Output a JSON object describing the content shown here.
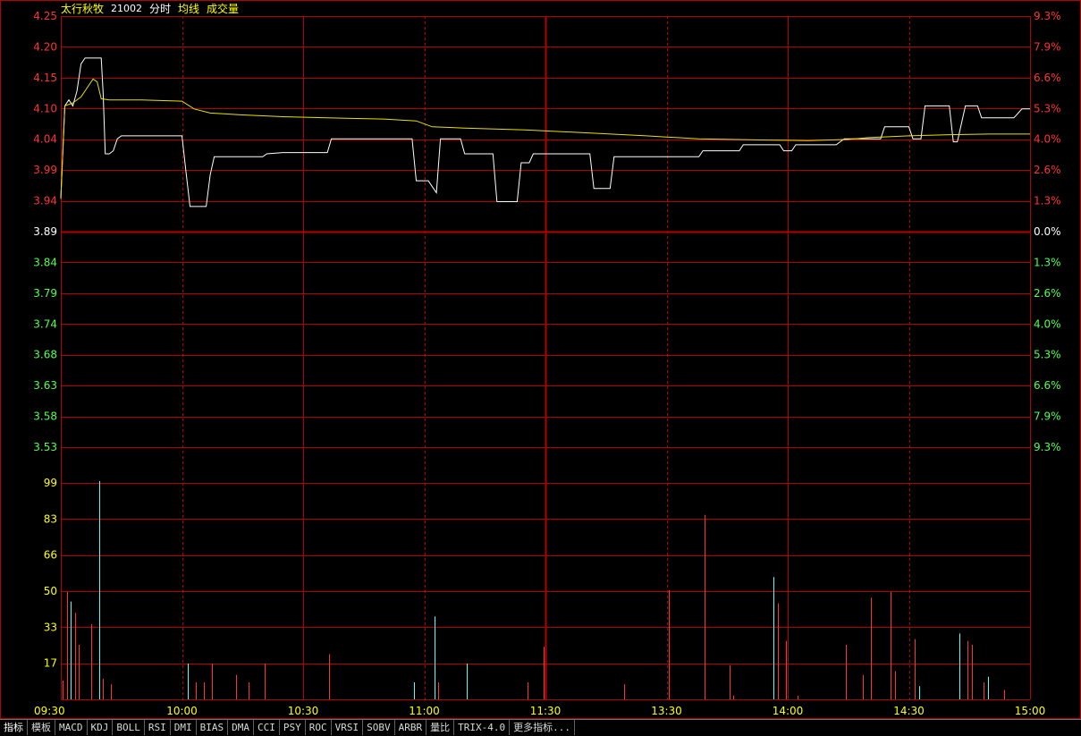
{
  "header": {
    "stock_name": "太行秋牧",
    "stock_code": "21002",
    "legend_price": "分时",
    "legend_avg": "均线",
    "legend_volume": "成交量"
  },
  "colors": {
    "background": "#000000",
    "grid": "#b40000",
    "price_line": "#ffffff",
    "avg_line": "#e8e000",
    "up": "#ff3232",
    "down": "#50ff50",
    "neutral": "#ffffff",
    "volume_up": "#ff3232",
    "volume_down": "#50ffff",
    "volume_axis": "#ffff00",
    "time_axis": "#ffff00"
  },
  "chart_data": {
    "type": "line",
    "price_axis": {
      "ticks": [
        "4.25",
        "4.20",
        "4.15",
        "4.10",
        "4.04",
        "3.99",
        "3.94",
        "3.89",
        "3.84",
        "3.79",
        "3.74",
        "3.68",
        "3.63",
        "3.58",
        "3.53"
      ],
      "prev_close": 3.89,
      "ylim": [
        3.53,
        4.25
      ]
    },
    "percent_axis": {
      "ticks": [
        "9.3%",
        "7.9%",
        "6.6%",
        "5.3%",
        "4.0%",
        "2.6%",
        "1.3%",
        "0.0%",
        "1.3%",
        "2.6%",
        "4.0%",
        "5.3%",
        "6.6%",
        "7.9%",
        "9.3%"
      ]
    },
    "volume_axis": {
      "ticks": [
        "99",
        "83",
        "66",
        "50",
        "33",
        "17"
      ],
      "ylim": [
        0,
        115
      ]
    },
    "time_axis": {
      "ticks": [
        "09:30",
        "10:00",
        "10:30",
        "11:00",
        "11:30",
        "13:30",
        "14:00",
        "14:30",
        "15:00"
      ],
      "total_minutes": 240
    },
    "series": [
      {
        "name": "分时",
        "points": [
          [
            0,
            3.945
          ],
          [
            1,
            4.1
          ],
          [
            2,
            4.11
          ],
          [
            3,
            4.1
          ],
          [
            4,
            4.125
          ],
          [
            5,
            4.17
          ],
          [
            6,
            4.18
          ],
          [
            7,
            4.18
          ],
          [
            8,
            4.18
          ],
          [
            9,
            4.18
          ],
          [
            10,
            4.18
          ],
          [
            10.5,
            4.12
          ],
          [
            11,
            4.02
          ],
          [
            12,
            4.02
          ],
          [
            13,
            4.025
          ],
          [
            14,
            4.045
          ],
          [
            15,
            4.05
          ],
          [
            16,
            4.05
          ],
          [
            25,
            4.05
          ],
          [
            30,
            4.05
          ],
          [
            31,
            3.99
          ],
          [
            32,
            3.932
          ],
          [
            35,
            3.932
          ],
          [
            36,
            3.932
          ],
          [
            37,
            3.985
          ],
          [
            38,
            4.015
          ],
          [
            42,
            4.015
          ],
          [
            50,
            4.015
          ],
          [
            51,
            4.02
          ],
          [
            55,
            4.022
          ],
          [
            66,
            4.022
          ],
          [
            67,
            4.045
          ],
          [
            70,
            4.045
          ],
          [
            86,
            4.045
          ],
          [
            87,
            4.045
          ],
          [
            88,
            3.975
          ],
          [
            91,
            3.975
          ],
          [
            92,
            3.965
          ],
          [
            93,
            3.955
          ],
          [
            94,
            4.045
          ],
          [
            99,
            4.045
          ],
          [
            100,
            4.02
          ],
          [
            107,
            4.02
          ],
          [
            108,
            3.94
          ],
          [
            113,
            3.94
          ],
          [
            114,
            4.005
          ],
          [
            116,
            4.005
          ],
          [
            117,
            4.02
          ],
          [
            131,
            4.02
          ],
          [
            132,
            3.962
          ],
          [
            136,
            3.962
          ],
          [
            137,
            4.015
          ],
          [
            142,
            4.015
          ],
          [
            158,
            4.015
          ],
          [
            159,
            4.025
          ],
          [
            164,
            4.025
          ],
          [
            168,
            4.025
          ],
          [
            169,
            4.035
          ],
          [
            178,
            4.035
          ],
          [
            179,
            4.025
          ],
          [
            181,
            4.025
          ],
          [
            182,
            4.035
          ],
          [
            192,
            4.035
          ],
          [
            194,
            4.045
          ],
          [
            203,
            4.045
          ],
          [
            204,
            4.065
          ],
          [
            210,
            4.065
          ],
          [
            211,
            4.045
          ],
          [
            213,
            4.045
          ],
          [
            214,
            4.1
          ],
          [
            220,
            4.1
          ],
          [
            221,
            4.04
          ],
          [
            222,
            4.04
          ],
          [
            223,
            4.07
          ],
          [
            224,
            4.1
          ],
          [
            227,
            4.1
          ],
          [
            228,
            4.08
          ],
          [
            236,
            4.08
          ],
          [
            238,
            4.095
          ],
          [
            240,
            4.095
          ]
        ]
      },
      {
        "name": "均线",
        "points": [
          [
            0,
            3.945
          ],
          [
            1,
            4.1
          ],
          [
            3,
            4.105
          ],
          [
            5,
            4.115
          ],
          [
            7,
            4.135
          ],
          [
            8,
            4.145
          ],
          [
            9,
            4.14
          ],
          [
            10,
            4.112
          ],
          [
            12,
            4.11
          ],
          [
            20,
            4.11
          ],
          [
            30,
            4.108
          ],
          [
            33,
            4.095
          ],
          [
            37,
            4.088
          ],
          [
            45,
            4.085
          ],
          [
            55,
            4.082
          ],
          [
            66,
            4.08
          ],
          [
            80,
            4.078
          ],
          [
            88,
            4.075
          ],
          [
            92,
            4.065
          ],
          [
            100,
            4.063
          ],
          [
            115,
            4.06
          ],
          [
            130,
            4.055
          ],
          [
            145,
            4.05
          ],
          [
            150,
            4.048
          ],
          [
            158,
            4.045
          ],
          [
            175,
            4.043
          ],
          [
            185,
            4.042
          ],
          [
            195,
            4.044
          ],
          [
            200,
            4.047
          ],
          [
            210,
            4.05
          ],
          [
            220,
            4.052
          ],
          [
            230,
            4.053
          ],
          [
            240,
            4.053
          ]
        ]
      }
    ],
    "volume_bars": [
      [
        0,
        10,
        "up"
      ],
      [
        1,
        57,
        "up"
      ],
      [
        2,
        52,
        "down"
      ],
      [
        3,
        46,
        "up"
      ],
      [
        4,
        29,
        "up"
      ],
      [
        7,
        40,
        "up"
      ],
      [
        9,
        116,
        "down"
      ],
      [
        10,
        11,
        "up"
      ],
      [
        12,
        8,
        "up"
      ],
      [
        31,
        19,
        "down"
      ],
      [
        33,
        9,
        "up"
      ],
      [
        35,
        9,
        "up"
      ],
      [
        37,
        19,
        "up"
      ],
      [
        43,
        13,
        "up"
      ],
      [
        46,
        9,
        "up"
      ],
      [
        50,
        19,
        "up"
      ],
      [
        66,
        24,
        "up"
      ],
      [
        87,
        9,
        "down"
      ],
      [
        92,
        44,
        "down"
      ],
      [
        93,
        9,
        "up"
      ],
      [
        100,
        19,
        "down"
      ],
      [
        115,
        9,
        "up"
      ],
      [
        119,
        28,
        "up"
      ],
      [
        139,
        8,
        "up"
      ],
      [
        150,
        58,
        "up"
      ],
      [
        159,
        98,
        "up"
      ],
      [
        165,
        18,
        "up"
      ],
      [
        166,
        2,
        "up"
      ],
      [
        176,
        65,
        "down"
      ],
      [
        177,
        51,
        "up"
      ],
      [
        179,
        31,
        "up"
      ],
      [
        182,
        2,
        "up"
      ],
      [
        194,
        29,
        "up"
      ],
      [
        198,
        13,
        "up"
      ],
      [
        200,
        54,
        "up"
      ],
      [
        205,
        57,
        "up"
      ],
      [
        206,
        15,
        "up"
      ],
      [
        211,
        32,
        "up"
      ],
      [
        212,
        7,
        "down"
      ],
      [
        222,
        35,
        "down"
      ],
      [
        224,
        31,
        "up"
      ],
      [
        225,
        29,
        "up"
      ],
      [
        228,
        9,
        "up"
      ],
      [
        229,
        12,
        "down"
      ],
      [
        233,
        5,
        "up"
      ]
    ]
  },
  "toolbar": {
    "tabs": [
      "指标",
      "模板",
      "MACD",
      "KDJ",
      "BOLL",
      "RSI",
      "DMI",
      "BIAS",
      "DMA",
      "CCI",
      "PSY",
      "ROC",
      "VRSI",
      "SOBV",
      "ARBR",
      "量比",
      "TRIX-4.0",
      "更多指标..."
    ]
  }
}
